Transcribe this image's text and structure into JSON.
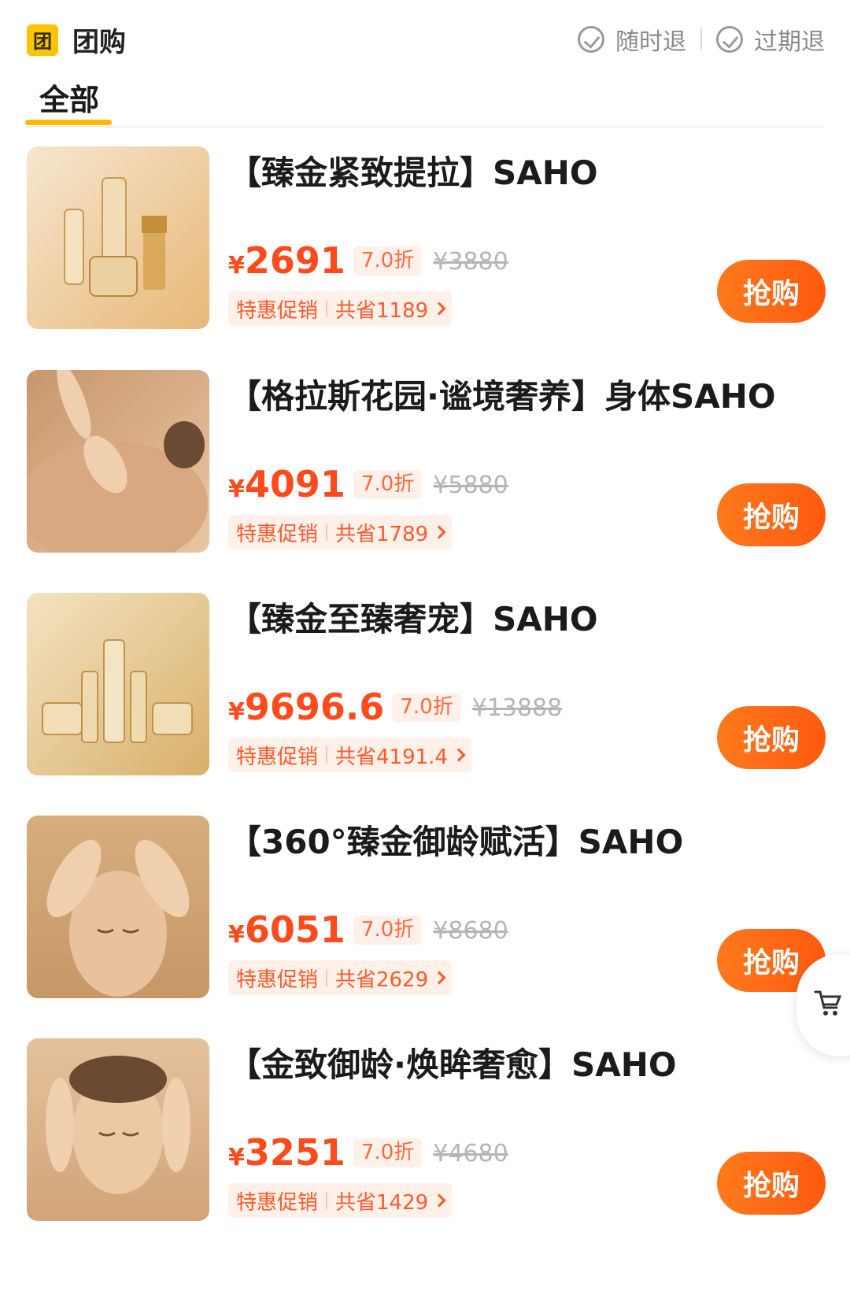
{
  "header": {
    "badge_char": "团",
    "title": "团购",
    "guarantees": [
      "随时退",
      "过期退"
    ]
  },
  "tabs": [
    {
      "label": "全部",
      "active": true
    }
  ],
  "colors": {
    "accent": "#ffba00",
    "price": "#ff4a1c",
    "button": "#ff6a14"
  },
  "items": [
    {
      "title": "【臻金紧致提拉】SAHO",
      "price_symbol": "¥",
      "price": "2691",
      "discount": "7.0折",
      "original_price": "¥3880",
      "promo_label": "特惠促销",
      "saving": "共省1189",
      "button": "抢购"
    },
    {
      "title": "【格拉斯花园·谧境奢养】身体SAHO",
      "price_symbol": "¥",
      "price": "4091",
      "discount": "7.0折",
      "original_price": "¥5880",
      "promo_label": "特惠促销",
      "saving": "共省1789",
      "button": "抢购"
    },
    {
      "title": "【臻金至臻奢宠】SAHO",
      "price_symbol": "¥",
      "price": "9696.6",
      "discount": "7.0折",
      "original_price": "¥13888",
      "promo_label": "特惠促销",
      "saving": "共省4191.4",
      "button": "抢购"
    },
    {
      "title": "【360°臻金御龄赋活】SAHO",
      "price_symbol": "¥",
      "price": "6051",
      "discount": "7.0折",
      "original_price": "¥8680",
      "promo_label": "特惠促销",
      "saving": "共省2629",
      "button": "抢购"
    },
    {
      "title": "【金致御龄·焕眸奢愈】SAHO",
      "price_symbol": "¥",
      "price": "3251",
      "discount": "7.0折",
      "original_price": "¥4680",
      "promo_label": "特惠促销",
      "saving": "共省1429",
      "button": "抢购"
    }
  ]
}
